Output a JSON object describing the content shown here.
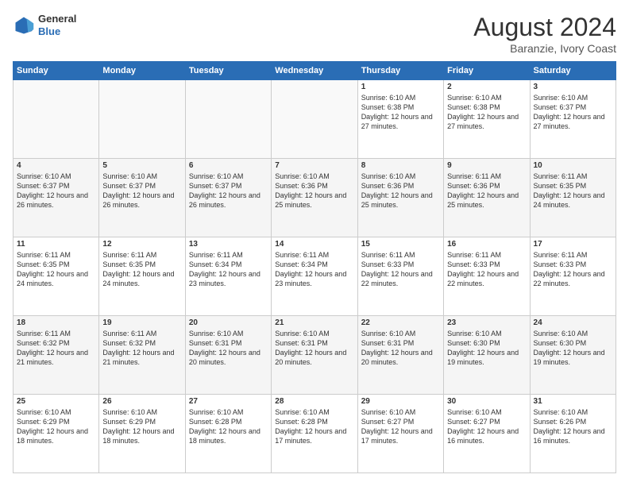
{
  "header": {
    "logo_general": "General",
    "logo_blue": "Blue",
    "month_title": "August 2024",
    "subtitle": "Baranzie, Ivory Coast"
  },
  "weekdays": [
    "Sunday",
    "Monday",
    "Tuesday",
    "Wednesday",
    "Thursday",
    "Friday",
    "Saturday"
  ],
  "weeks": [
    [
      {
        "num": "",
        "info": ""
      },
      {
        "num": "",
        "info": ""
      },
      {
        "num": "",
        "info": ""
      },
      {
        "num": "",
        "info": ""
      },
      {
        "num": "1",
        "info": "Sunrise: 6:10 AM\nSunset: 6:38 PM\nDaylight: 12 hours and 27 minutes."
      },
      {
        "num": "2",
        "info": "Sunrise: 6:10 AM\nSunset: 6:38 PM\nDaylight: 12 hours and 27 minutes."
      },
      {
        "num": "3",
        "info": "Sunrise: 6:10 AM\nSunset: 6:37 PM\nDaylight: 12 hours and 27 minutes."
      }
    ],
    [
      {
        "num": "4",
        "info": "Sunrise: 6:10 AM\nSunset: 6:37 PM\nDaylight: 12 hours and 26 minutes."
      },
      {
        "num": "5",
        "info": "Sunrise: 6:10 AM\nSunset: 6:37 PM\nDaylight: 12 hours and 26 minutes."
      },
      {
        "num": "6",
        "info": "Sunrise: 6:10 AM\nSunset: 6:37 PM\nDaylight: 12 hours and 26 minutes."
      },
      {
        "num": "7",
        "info": "Sunrise: 6:10 AM\nSunset: 6:36 PM\nDaylight: 12 hours and 25 minutes."
      },
      {
        "num": "8",
        "info": "Sunrise: 6:10 AM\nSunset: 6:36 PM\nDaylight: 12 hours and 25 minutes."
      },
      {
        "num": "9",
        "info": "Sunrise: 6:11 AM\nSunset: 6:36 PM\nDaylight: 12 hours and 25 minutes."
      },
      {
        "num": "10",
        "info": "Sunrise: 6:11 AM\nSunset: 6:35 PM\nDaylight: 12 hours and 24 minutes."
      }
    ],
    [
      {
        "num": "11",
        "info": "Sunrise: 6:11 AM\nSunset: 6:35 PM\nDaylight: 12 hours and 24 minutes."
      },
      {
        "num": "12",
        "info": "Sunrise: 6:11 AM\nSunset: 6:35 PM\nDaylight: 12 hours and 24 minutes."
      },
      {
        "num": "13",
        "info": "Sunrise: 6:11 AM\nSunset: 6:34 PM\nDaylight: 12 hours and 23 minutes."
      },
      {
        "num": "14",
        "info": "Sunrise: 6:11 AM\nSunset: 6:34 PM\nDaylight: 12 hours and 23 minutes."
      },
      {
        "num": "15",
        "info": "Sunrise: 6:11 AM\nSunset: 6:33 PM\nDaylight: 12 hours and 22 minutes."
      },
      {
        "num": "16",
        "info": "Sunrise: 6:11 AM\nSunset: 6:33 PM\nDaylight: 12 hours and 22 minutes."
      },
      {
        "num": "17",
        "info": "Sunrise: 6:11 AM\nSunset: 6:33 PM\nDaylight: 12 hours and 22 minutes."
      }
    ],
    [
      {
        "num": "18",
        "info": "Sunrise: 6:11 AM\nSunset: 6:32 PM\nDaylight: 12 hours and 21 minutes."
      },
      {
        "num": "19",
        "info": "Sunrise: 6:11 AM\nSunset: 6:32 PM\nDaylight: 12 hours and 21 minutes."
      },
      {
        "num": "20",
        "info": "Sunrise: 6:10 AM\nSunset: 6:31 PM\nDaylight: 12 hours and 20 minutes."
      },
      {
        "num": "21",
        "info": "Sunrise: 6:10 AM\nSunset: 6:31 PM\nDaylight: 12 hours and 20 minutes."
      },
      {
        "num": "22",
        "info": "Sunrise: 6:10 AM\nSunset: 6:31 PM\nDaylight: 12 hours and 20 minutes."
      },
      {
        "num": "23",
        "info": "Sunrise: 6:10 AM\nSunset: 6:30 PM\nDaylight: 12 hours and 19 minutes."
      },
      {
        "num": "24",
        "info": "Sunrise: 6:10 AM\nSunset: 6:30 PM\nDaylight: 12 hours and 19 minutes."
      }
    ],
    [
      {
        "num": "25",
        "info": "Sunrise: 6:10 AM\nSunset: 6:29 PM\nDaylight: 12 hours and 18 minutes."
      },
      {
        "num": "26",
        "info": "Sunrise: 6:10 AM\nSunset: 6:29 PM\nDaylight: 12 hours and 18 minutes."
      },
      {
        "num": "27",
        "info": "Sunrise: 6:10 AM\nSunset: 6:28 PM\nDaylight: 12 hours and 18 minutes."
      },
      {
        "num": "28",
        "info": "Sunrise: 6:10 AM\nSunset: 6:28 PM\nDaylight: 12 hours and 17 minutes."
      },
      {
        "num": "29",
        "info": "Sunrise: 6:10 AM\nSunset: 6:27 PM\nDaylight: 12 hours and 17 minutes."
      },
      {
        "num": "30",
        "info": "Sunrise: 6:10 AM\nSunset: 6:27 PM\nDaylight: 12 hours and 16 minutes."
      },
      {
        "num": "31",
        "info": "Sunrise: 6:10 AM\nSunset: 6:26 PM\nDaylight: 12 hours and 16 minutes."
      }
    ]
  ]
}
